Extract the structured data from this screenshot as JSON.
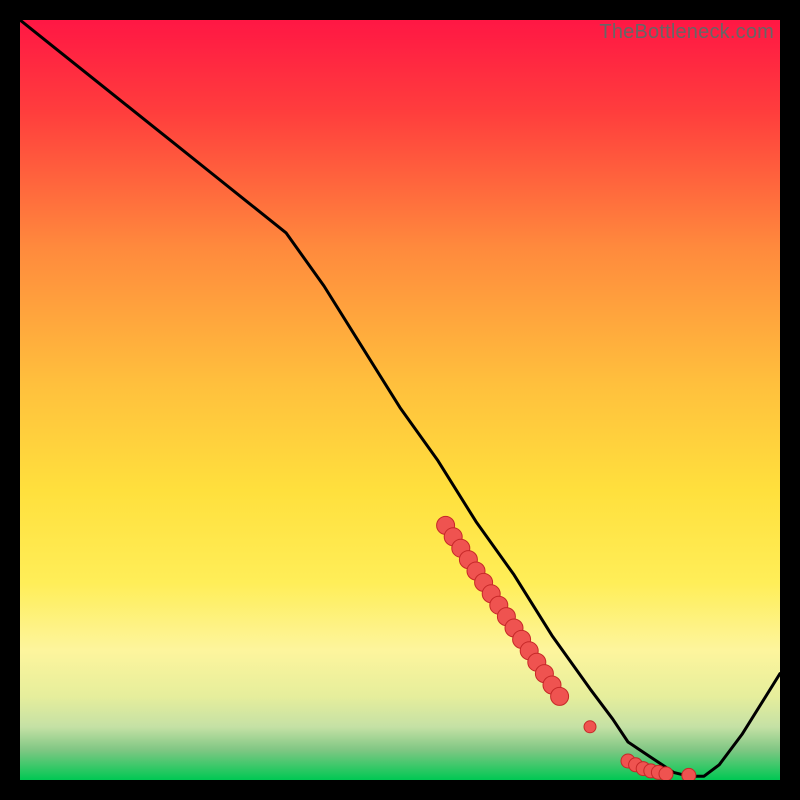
{
  "watermark": "TheBottleneck.com",
  "colors": {
    "background": "#000000",
    "gradient_top": "#ff1744",
    "gradient_mid1": "#ffb300",
    "gradient_mid2": "#ffee58",
    "gradient_mid3": "#fff59d",
    "gradient_lime": "#d4e157",
    "gradient_bottom": "#00e676",
    "line": "#000000",
    "dot": "#ef5350",
    "dot_stroke": "#c62828"
  },
  "chart_data": {
    "type": "line",
    "title": "",
    "xlabel": "",
    "ylabel": "",
    "xlim": [
      0,
      100
    ],
    "ylim": [
      0,
      100
    ],
    "x": [
      0,
      5,
      10,
      15,
      20,
      25,
      30,
      35,
      40,
      45,
      50,
      55,
      60,
      65,
      70,
      75,
      78,
      80,
      83,
      86,
      88,
      90,
      92,
      95,
      100
    ],
    "y": [
      100,
      96,
      92,
      88,
      84,
      80,
      76,
      72,
      65,
      57,
      49,
      42,
      34,
      27,
      19,
      12,
      8,
      5,
      3,
      1,
      0.5,
      0.5,
      2,
      6,
      14
    ],
    "highlight_points": {
      "x": [
        56,
        57,
        58,
        59,
        60,
        61,
        62,
        63,
        64,
        65,
        66,
        67,
        68,
        69,
        70,
        71,
        75,
        80,
        81,
        82,
        83,
        84,
        85,
        88
      ],
      "y": [
        33.5,
        32,
        30.5,
        29,
        27.5,
        26,
        24.5,
        23,
        21.5,
        20,
        18.5,
        17,
        15.5,
        14,
        12.5,
        11,
        7,
        2.5,
        2,
        1.5,
        1.2,
        1,
        0.8,
        0.6
      ]
    }
  }
}
